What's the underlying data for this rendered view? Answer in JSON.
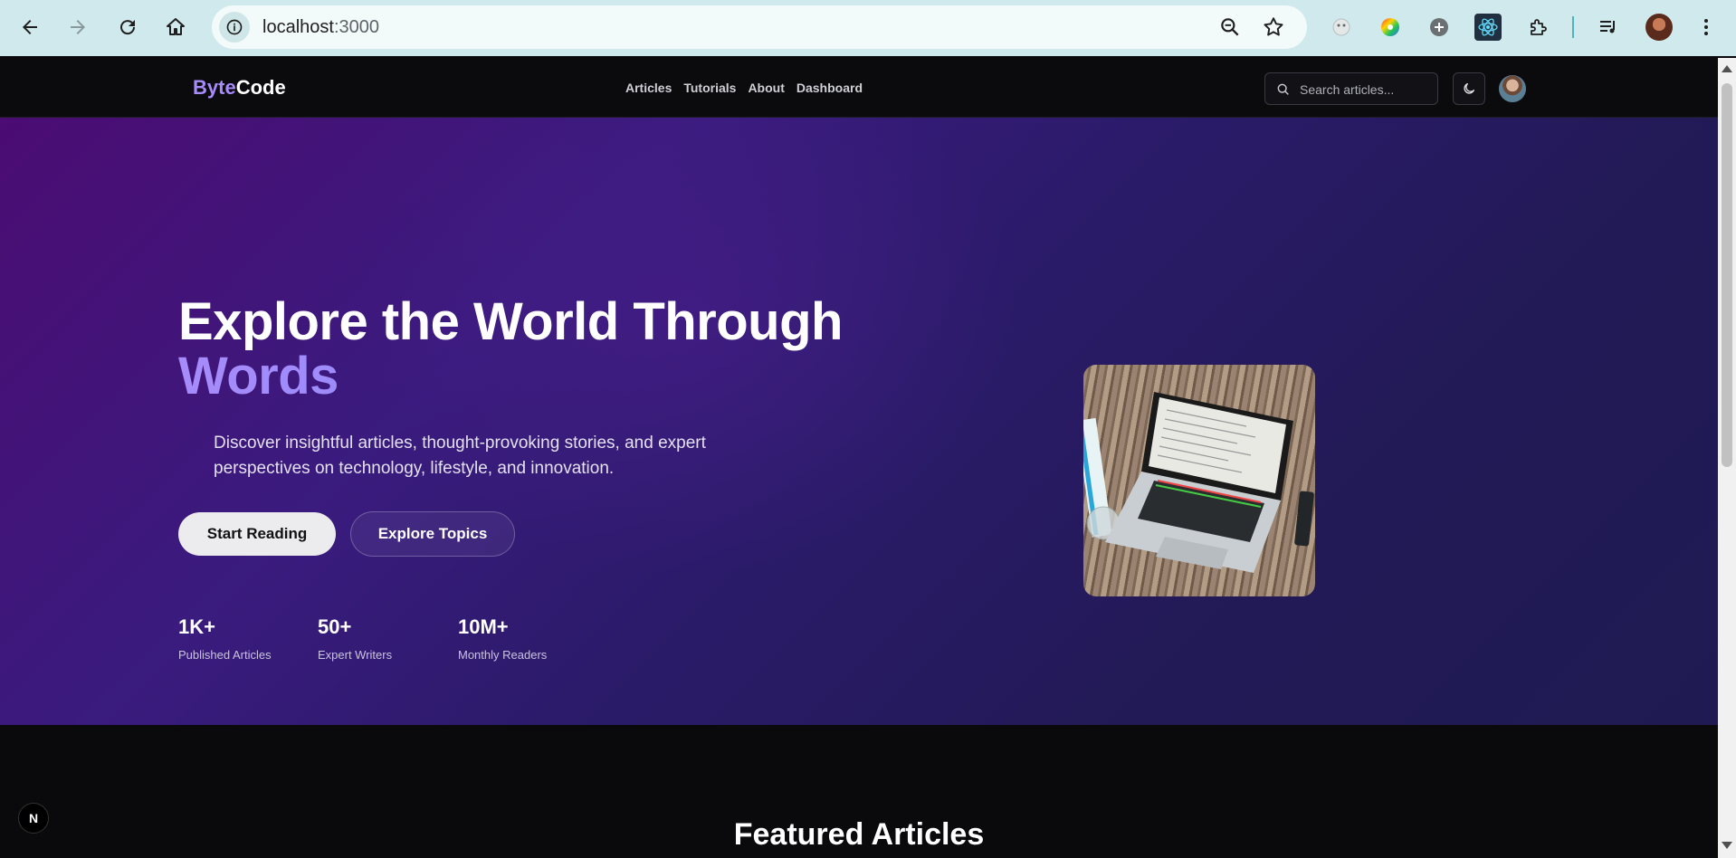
{
  "browser": {
    "url_host": "localhost",
    "url_port": ":3000",
    "icons": {
      "back": "back-arrow-icon",
      "forward": "forward-arrow-icon",
      "reload": "reload-icon",
      "home": "home-icon",
      "info": "info-icon",
      "zoom": "zoom-icon",
      "bookmark": "star-icon"
    }
  },
  "header": {
    "logo_part1": "Byte",
    "logo_part2": "Code",
    "nav": [
      "Articles",
      "Tutorials",
      "About",
      "Dashboard"
    ],
    "search_placeholder": "Search articles..."
  },
  "hero": {
    "title_line1": "Explore the World Through",
    "title_line2": "Words",
    "description": "Discover insightful articles, thought-provoking stories, and expert perspectives on technology, lifestyle, and innovation.",
    "primary_button": "Start Reading",
    "secondary_button": "Explore Topics",
    "stats": [
      {
        "value": "1K+",
        "label": "Published Articles"
      },
      {
        "value": "50+",
        "label": "Expert Writers"
      },
      {
        "value": "10M+",
        "label": "Monthly Readers"
      }
    ]
  },
  "featured": {
    "heading": "Featured Articles"
  },
  "badge": "N",
  "colors": {
    "accent": "#a78bfa",
    "hero_start": "#4b0c73",
    "hero_end": "#1f1b52"
  }
}
